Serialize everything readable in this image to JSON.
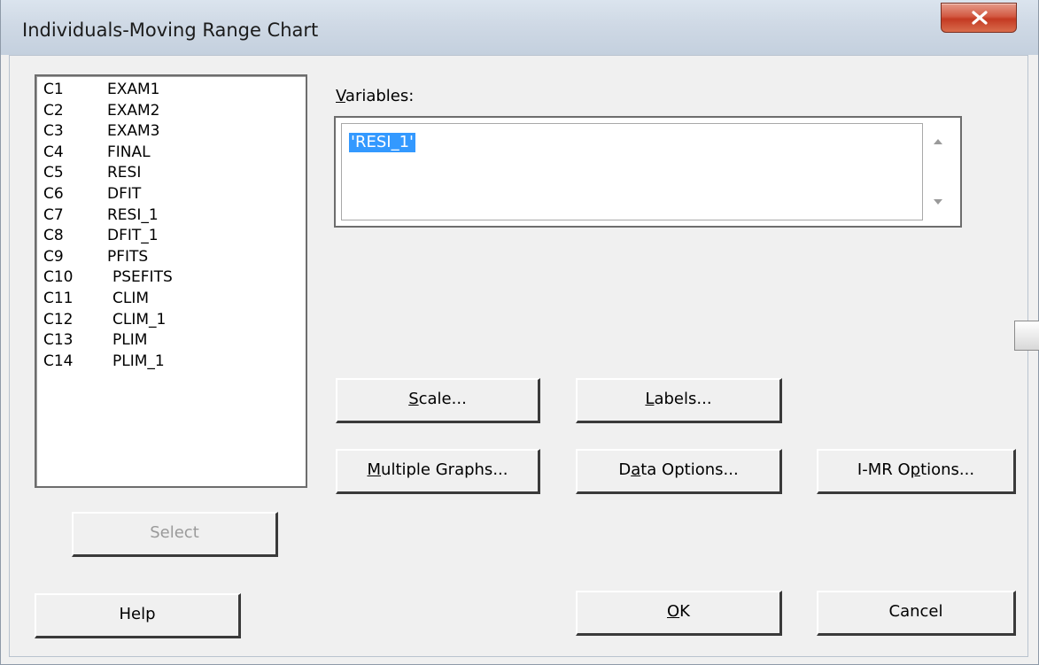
{
  "window": {
    "title": "Individuals-Moving Range Chart"
  },
  "variable_list": {
    "items": [
      {
        "col": "C1",
        "name": "EXAM1"
      },
      {
        "col": "C2",
        "name": "EXAM2"
      },
      {
        "col": "C3",
        "name": "EXAM3"
      },
      {
        "col": "C4",
        "name": "FINAL"
      },
      {
        "col": "C5",
        "name": "RESI"
      },
      {
        "col": "C6",
        "name": "DFIT"
      },
      {
        "col": "C7",
        "name": "RESI_1"
      },
      {
        "col": "C8",
        "name": "DFIT_1"
      },
      {
        "col": "C9",
        "name": "PFITS"
      },
      {
        "col": "C10",
        "name": "PSEFITS"
      },
      {
        "col": "C11",
        "name": "CLIM"
      },
      {
        "col": "C12",
        "name": "CLIM_1"
      },
      {
        "col": "C13",
        "name": "PLIM"
      },
      {
        "col": "C14",
        "name": "PLIM_1"
      }
    ]
  },
  "variables": {
    "label_first": "V",
    "label_rest": "ariables:",
    "value": "'RESI_1'"
  },
  "buttons": {
    "select": "Select",
    "scale_u": "S",
    "scale_rest": "cale...",
    "labels_u": "L",
    "labels_rest": "abels...",
    "multiple_u": "M",
    "multiple_rest": "ultiple Graphs...",
    "data_pre": "D",
    "data_u": "a",
    "data_rest": "ta Options...",
    "imr_pre": "I-MR O",
    "imr_u": "p",
    "imr_rest": "tions...",
    "help": "Help",
    "ok_u": "O",
    "ok_rest": "K",
    "cancel": "Cancel"
  },
  "colors": {
    "selection": "#3399ff",
    "close_button": "#c94a32"
  },
  "icons": {
    "close": "close-x-icon",
    "scroll_up": "triangle-up-icon",
    "scroll_down": "triangle-down-icon"
  }
}
